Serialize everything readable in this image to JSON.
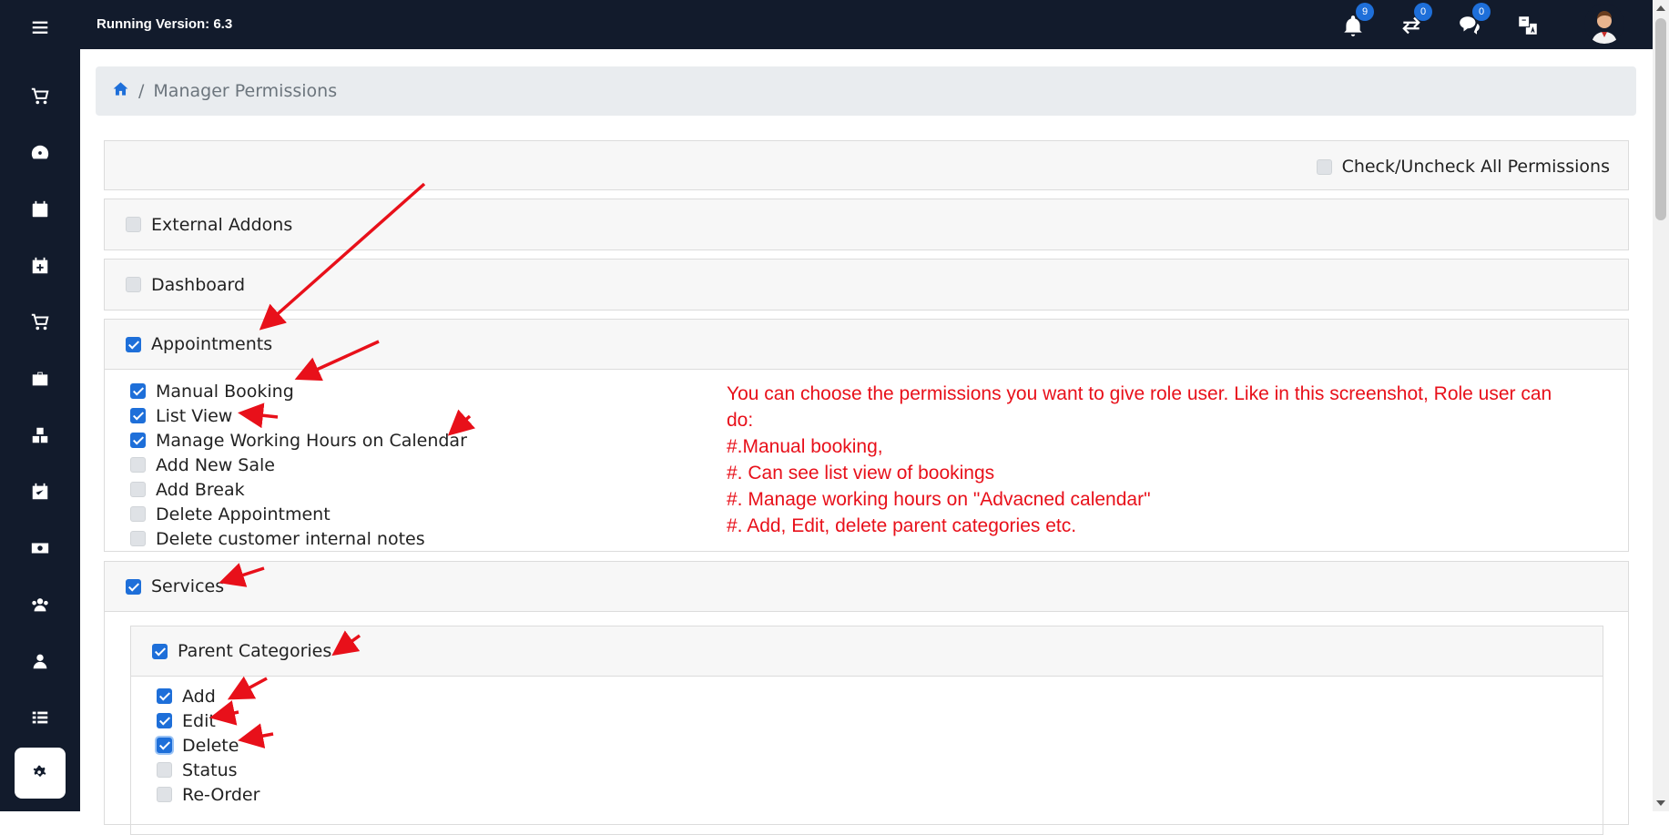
{
  "app": {
    "version_text": "Running Version: 6.3"
  },
  "topbar": {
    "notifications_count": "9",
    "transfers_count": "0",
    "messages_count": "0"
  },
  "breadcrumb": {
    "current": "Manager Permissions",
    "separator": "/"
  },
  "permissions": {
    "check_all_label": "Check/Uncheck All Permissions",
    "external_addons": "External Addons",
    "dashboard": "Dashboard",
    "appointments": {
      "label": "Appointments",
      "items": [
        {
          "label": "Manual Booking",
          "checked": true
        },
        {
          "label": "List View",
          "checked": true
        },
        {
          "label": "Manage Working Hours on Calendar",
          "checked": true
        },
        {
          "label": "Add New Sale",
          "checked": false
        },
        {
          "label": "Add Break",
          "checked": false
        },
        {
          "label": "Delete Appointment",
          "checked": false
        },
        {
          "label": "Delete customer internal notes",
          "checked": false
        }
      ]
    },
    "services": {
      "label": "Services",
      "parent_categories": {
        "label": "Parent Categories",
        "items": [
          {
            "label": "Add",
            "checked": true
          },
          {
            "label": "Edit",
            "checked": true
          },
          {
            "label": "Delete",
            "checked": true
          },
          {
            "label": "Status",
            "checked": false
          },
          {
            "label": "Re-Order",
            "checked": false
          }
        ]
      }
    }
  },
  "annotation": {
    "lines": [
      "You can choose the permissions you want to give role user. Like in this screenshot, Role user can do:",
      "#.Manual booking,",
      "#. Can see list view of bookings",
      "#. Manage working hours on \"Advacned calendar\"",
      "#. Add, Edit, delete parent categories etc."
    ]
  },
  "colors": {
    "sidebar": "#121b2c",
    "accent": "#1e6fd9",
    "annotation": "#e8101a"
  }
}
